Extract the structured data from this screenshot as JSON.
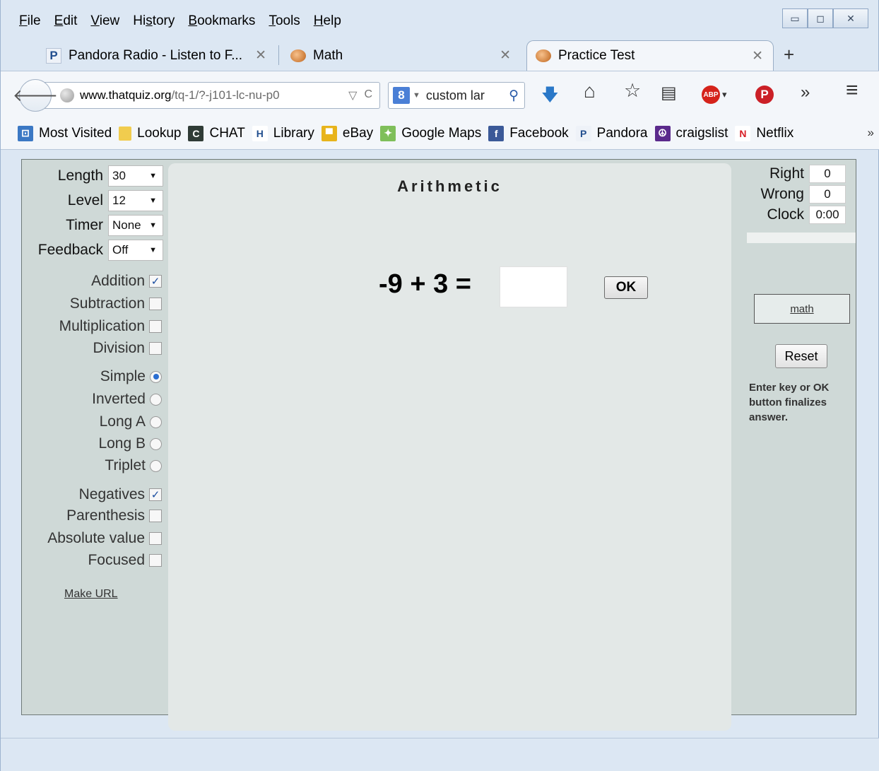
{
  "menu": {
    "items": [
      {
        "label": "File",
        "accel": "F",
        "rest": "ile"
      },
      {
        "label": "Edit",
        "accel": "E",
        "rest": "dit"
      },
      {
        "label": "View",
        "accel": "V",
        "rest": "iew"
      },
      {
        "label": "History",
        "pre": "Hi",
        "accel": "s",
        "rest": "tory"
      },
      {
        "label": "Bookmarks",
        "accel": "B",
        "rest": "ookmarks"
      },
      {
        "label": "Tools",
        "accel": "T",
        "rest": "ools"
      },
      {
        "label": "Help",
        "accel": "H",
        "rest": "elp"
      }
    ]
  },
  "window_controls": {
    "minimize": "▭",
    "maximize": "◻",
    "close": "✕"
  },
  "tabs": [
    {
      "title": "Pandora Radio - Listen to F...",
      "icon": "pandora-icon",
      "close": "✕"
    },
    {
      "title": "Math",
      "icon": "brain-icon",
      "close": "✕"
    },
    {
      "title": "Practice Test",
      "icon": "brain-icon",
      "close": "✕"
    }
  ],
  "new_tab_label": "+",
  "navbar": {
    "back": "🡐",
    "url_domain": "www.thatquiz.org",
    "url_path": "/tq-1/?-j101-lc-nu-p0",
    "url_dropdown": "▽",
    "reload": "C",
    "search_engine": "8",
    "search_text": "custom lar",
    "search_icon": "⚲",
    "download_icon": "🡇",
    "home_icon": "⌂",
    "star_icon": "☆",
    "reader_icon": "▤",
    "abp_label": "ABP",
    "abp_dropdown": "▾",
    "pinterest_label": "P",
    "overflow": "»",
    "menu_icon": "≡"
  },
  "bookmarks": [
    {
      "label": "Most Visited",
      "icon": "most-visited-icon",
      "color": "#3b78c4",
      "glyph": "⊡"
    },
    {
      "label": "Lookup",
      "icon": "folder-icon",
      "color": "#f1cc4e",
      "glyph": ""
    },
    {
      "label": "CHAT",
      "icon": "chat-icon",
      "color": "#2f3b36",
      "glyph": "C"
    },
    {
      "label": "Library",
      "icon": "library-icon",
      "color": "#ffffff",
      "glyph": "H"
    },
    {
      "label": "eBay",
      "icon": "ebay-icon",
      "color": "#e8b41c",
      "glyph": "▀"
    },
    {
      "label": "Google Maps",
      "icon": "maps-icon",
      "color": "#7fbf5a",
      "glyph": "✦"
    },
    {
      "label": "Facebook",
      "icon": "facebook-icon",
      "color": "#3b5998",
      "glyph": "f"
    },
    {
      "label": "Pandora",
      "icon": "pandora-icon",
      "color": "#eef2f8",
      "glyph": "P"
    },
    {
      "label": "craigslist",
      "icon": "peace-icon",
      "color": "#5b2a8c",
      "glyph": "☮"
    },
    {
      "label": "Netflix",
      "icon": "netflix-icon",
      "color": "#ffffff",
      "glyph": "N"
    }
  ],
  "bookmarks_overflow": "»",
  "settings": [
    {
      "label": "Length",
      "value": "30"
    },
    {
      "label": "Level",
      "value": "12"
    },
    {
      "label": "Timer",
      "value": "None"
    },
    {
      "label": "Feedback",
      "value": "Off"
    }
  ],
  "select_arrow": "▼",
  "operations": [
    {
      "label": "Addition",
      "checked": true
    },
    {
      "label": "Subtraction",
      "checked": false
    },
    {
      "label": "Multiplication",
      "checked": false
    },
    {
      "label": "Division",
      "checked": false
    }
  ],
  "formats": [
    {
      "label": "Simple",
      "selected": true
    },
    {
      "label": "Inverted",
      "selected": false
    },
    {
      "label": "Long A",
      "selected": false
    },
    {
      "label": "Long B",
      "selected": false
    },
    {
      "label": "Triplet",
      "selected": false
    }
  ],
  "options": [
    {
      "label": "Negatives",
      "checked": true
    },
    {
      "label": "Parenthesis",
      "checked": false
    },
    {
      "label": "Absolute value",
      "checked": false
    },
    {
      "label": "Focused",
      "checked": false
    }
  ],
  "make_url": "Make URL",
  "quiz": {
    "title": "Arithmetic",
    "question": "-9 + 3 =",
    "answer_value": "",
    "ok_label": "OK"
  },
  "stats": [
    {
      "label": "Right",
      "value": "0"
    },
    {
      "label": "Wrong",
      "value": "0"
    },
    {
      "label": "Clock",
      "value": "0:00"
    }
  ],
  "progress_fraction": 0,
  "math_link": "math",
  "reset_label": "Reset",
  "hint": "Enter key or OK button finalizes answer.",
  "checkmark": "✓"
}
